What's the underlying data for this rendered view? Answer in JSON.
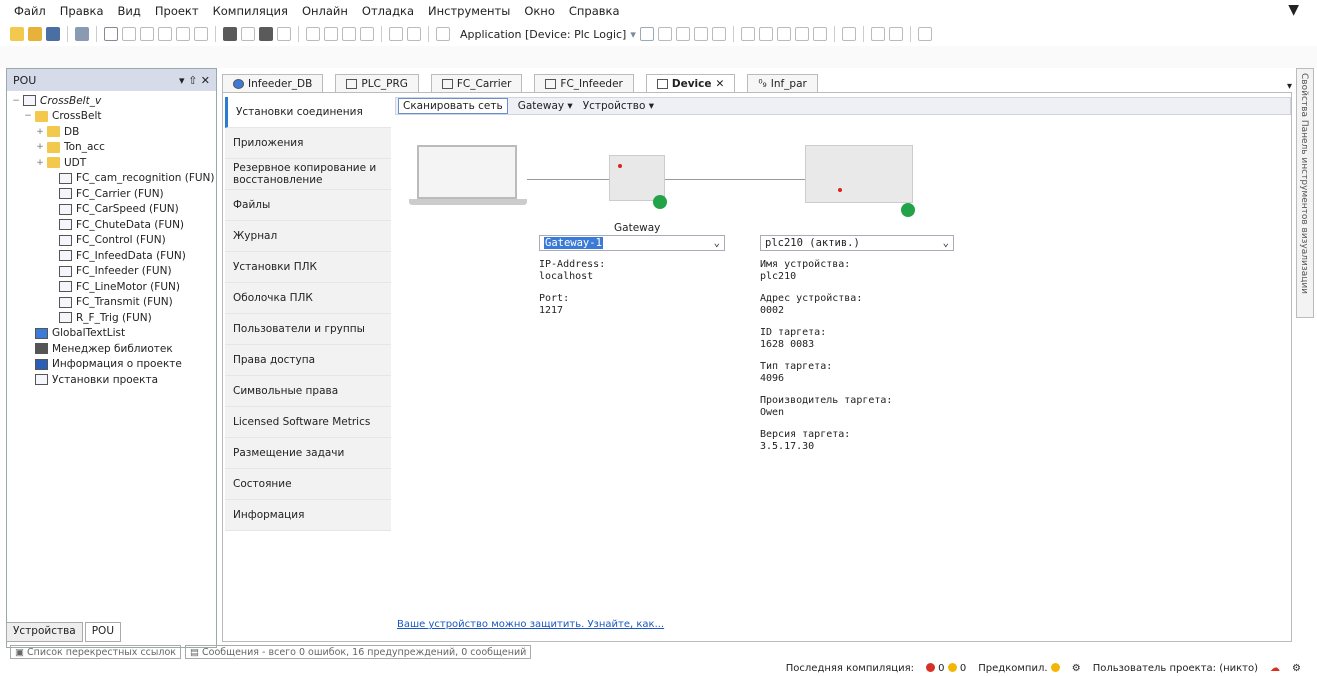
{
  "menu": [
    "Файл",
    "Правка",
    "Вид",
    "Проект",
    "Компиляция",
    "Онлайн",
    "Отладка",
    "Инструменты",
    "Окно",
    "Справка"
  ],
  "toolbar": {
    "application": "Application [Device: Plc Logic]"
  },
  "pou": {
    "title": "POU",
    "controls": "▾ ⇧ ✕",
    "tree": [
      {
        "indent": 0,
        "exp": "−",
        "icon": "project",
        "label": "CrossBelt_v"
      },
      {
        "indent": 1,
        "exp": "−",
        "icon": "folder",
        "label": "CrossBelt"
      },
      {
        "indent": 2,
        "exp": "+",
        "icon": "folder",
        "label": "DB"
      },
      {
        "indent": 2,
        "exp": "+",
        "icon": "folder",
        "label": "Ton_acc"
      },
      {
        "indent": 2,
        "exp": "+",
        "icon": "folder",
        "label": "UDT"
      },
      {
        "indent": 3,
        "exp": "",
        "icon": "fun",
        "label": "FC_cam_recognition (FUN)"
      },
      {
        "indent": 3,
        "exp": "",
        "icon": "fun",
        "label": "FC_Carrier (FUN)"
      },
      {
        "indent": 3,
        "exp": "",
        "icon": "fun",
        "label": "FC_CarSpeed (FUN)"
      },
      {
        "indent": 3,
        "exp": "",
        "icon": "fun",
        "label": "FC_ChuteData (FUN)"
      },
      {
        "indent": 3,
        "exp": "",
        "icon": "fun",
        "label": "FC_Control (FUN)"
      },
      {
        "indent": 3,
        "exp": "",
        "icon": "fun",
        "label": "FC_InfeedData (FUN)"
      },
      {
        "indent": 3,
        "exp": "",
        "icon": "fun",
        "label": "FC_Infeeder (FUN)"
      },
      {
        "indent": 3,
        "exp": "",
        "icon": "fun",
        "label": "FC_LineMotor (FUN)"
      },
      {
        "indent": 3,
        "exp": "",
        "icon": "fun",
        "label": "FC_Transmit (FUN)"
      },
      {
        "indent": 3,
        "exp": "",
        "icon": "fun",
        "label": "R_F_Trig (FUN)"
      },
      {
        "indent": 1,
        "exp": "",
        "icon": "textlist",
        "label": "GlobalTextList"
      },
      {
        "indent": 1,
        "exp": "",
        "icon": "library",
        "label": "Менеджер библиотек"
      },
      {
        "indent": 1,
        "exp": "",
        "icon": "info",
        "label": "Информация о проекте"
      },
      {
        "indent": 1,
        "exp": "",
        "icon": "settings",
        "label": "Установки проекта"
      }
    ],
    "bottom_tabs": [
      "Устройства",
      "POU"
    ]
  },
  "editor_tabs": [
    {
      "label": "Infeeder_DB",
      "active": false
    },
    {
      "label": "PLC_PRG",
      "active": false
    },
    {
      "label": "FC_Carrier",
      "active": false
    },
    {
      "label": "FC_Infeeder",
      "active": false
    },
    {
      "label": "Device",
      "active": true
    },
    {
      "label": "Inf_par",
      "active": false
    }
  ],
  "nav": [
    "Установки соединения",
    "Приложения",
    "Резервное копирование и восстановление",
    "Файлы",
    "Журнал",
    "Установки ПЛК",
    "Оболочка ПЛК",
    "Пользователи и группы",
    "Права доступа",
    "Символьные права",
    "Licensed Software Metrics",
    "Размещение задачи",
    "Состояние",
    "Информация"
  ],
  "content_toolbar": {
    "scan": "Сканировать сеть",
    "gateway": "Gateway ▾",
    "device": "Устройство ▾"
  },
  "gateway": {
    "label": "Gateway",
    "selected": "Gateway-1",
    "ip_label": "IP-Address:",
    "ip_value": "localhost",
    "port_label": "Port:",
    "port_value": "1217"
  },
  "device": {
    "selected": "plc210 (актив.)",
    "name_label": "Имя устройства:",
    "name_value": "plc210",
    "addr_label": "Адрес устройства:",
    "addr_value": "0002",
    "id_label": "ID таргета:",
    "id_value": "1628 0083",
    "type_label": "Тип таргета:",
    "type_value": "4096",
    "vendor_label": "Производитель таргета:",
    "vendor_value": "Owen",
    "ver_label": "Версия таргета:",
    "ver_value": "3.5.17.30"
  },
  "protect_link": "Ваше устройство можно защитить. Узнайте, как...",
  "right_strip": "Свойства Панель инструментов визуализации",
  "messages": [
    {
      "label": "Список перекрестных ссылок"
    },
    {
      "label": "Сообщения - всего 0 ошибок, 16 предупреждений, 0 сообщений"
    }
  ],
  "status": {
    "last_compile": "Последняя компиляция:",
    "errors": "0",
    "warnings": "0",
    "precompile": "Предкомпил.",
    "user": "Пользователь проекта: (никто)"
  },
  "colors": {
    "ok": "#22a34a",
    "error": "#d93025",
    "warn": "#f2b705",
    "link": "#1b57c4"
  }
}
